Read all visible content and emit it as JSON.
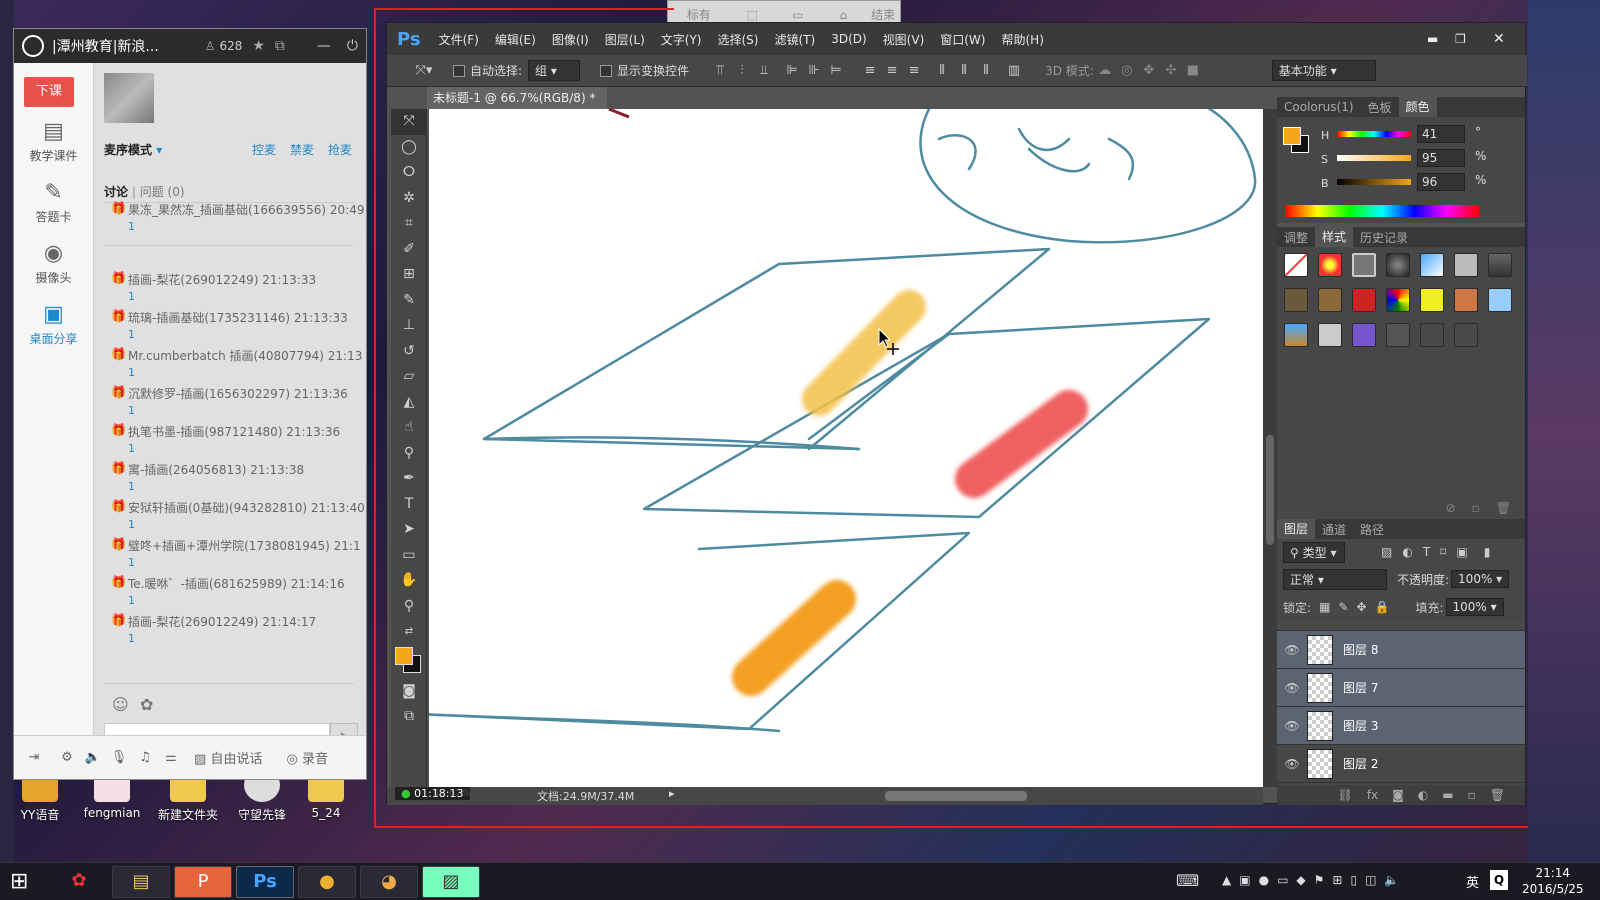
{
  "desktop": {
    "icons": [
      {
        "label": "YY语音"
      },
      {
        "label": "fengmian"
      },
      {
        "label": "新建文件夹"
      },
      {
        "label": "守望先锋"
      },
      {
        "label": "5_24"
      }
    ]
  },
  "top_toolbar": {
    "items": [
      "标有",
      "",
      "",
      "",
      "结束"
    ]
  },
  "yy": {
    "title": "|潭州教育|新浪...",
    "user_count": "628",
    "end_class": "下课",
    "sidebar": [
      "教学课件",
      "答题卡",
      "摄像头",
      "桌面分享"
    ],
    "mic_mode": "麦序模式",
    "actions": [
      "控麦",
      "禁麦",
      "抢麦"
    ],
    "tabs": {
      "discuss": "讨论",
      "questions": "问题 (0)"
    },
    "messages": [
      {
        "text": "果冻_果然冻_插画基础(166639556) 20:49",
        "num": "1"
      },
      {
        "text": "插画-梨花(269012249) 21:13:33",
        "num": "1"
      },
      {
        "text": "琉璃-插画基础(1735231146) 21:13:33",
        "num": "1"
      },
      {
        "text": "Mr.cumberbatch 插画(40807794) 21:13",
        "num": "1"
      },
      {
        "text": "沉默修罗-插画(1656302297) 21:13:36",
        "num": "1"
      },
      {
        "text": "执笔书墨-插画(987121480) 21:13:36",
        "num": "1"
      },
      {
        "text": "寓-插画(264056813) 21:13:38",
        "num": "1"
      },
      {
        "text": "安狱轩插画(0基础)(943282810) 21:13:40",
        "num": "1"
      },
      {
        "text": "璧咚+插画+潭州学院(1738081945) 21:1",
        "num": "1"
      },
      {
        "text": "Te.暖咻゛-插画(681625989) 21:14:16",
        "num": "1"
      },
      {
        "text": "插画-梨花(269012249) 21:14:17",
        "num": "1"
      }
    ],
    "bottom": {
      "free_talk": "自由说话",
      "record": "录音"
    }
  },
  "ps": {
    "logo": "Ps",
    "menu": [
      "文件(F)",
      "编辑(E)",
      "图像(I)",
      "图层(L)",
      "文字(Y)",
      "选择(S)",
      "滤镜(T)",
      "3D(D)",
      "视图(V)",
      "窗口(W)",
      "帮助(H)"
    ],
    "options": {
      "auto_select": "自动选择:",
      "group": "组",
      "show_transform": "显示变换控件",
      "mode_3d": "3D 模式:",
      "workspace": "基本功能"
    },
    "doc_tab": "未标题-1 @ 66.7%(RGB/8) *",
    "status": {
      "zoom": "66.67%",
      "doc": "文档:24.9M/37.4M",
      "timer": "01:18:13"
    },
    "color_tabs": [
      "Coolorus(1)",
      "色板",
      "颜色"
    ],
    "hsb": {
      "H": "41",
      "S": "95",
      "B": "96",
      "h_unit": "°",
      "s_unit": "%",
      "b_unit": "%"
    },
    "style_tabs": [
      "调整",
      "样式",
      "历史记录"
    ],
    "layers_tabs": [
      "图层",
      "通道",
      "路径"
    ],
    "layers_filter": "类型",
    "blend_mode": "正常",
    "opacity_label": "不透明度:",
    "opacity": "100%",
    "lock_label": "锁定:",
    "fill_label": "填充:",
    "fill": "100%",
    "layers": [
      {
        "name": "图层 8",
        "selected": true
      },
      {
        "name": "图层 7",
        "selected": true
      },
      {
        "name": "图层 3",
        "selected": true
      },
      {
        "name": "图层 2",
        "selected": false
      }
    ]
  },
  "taskbar": {
    "ime": "英",
    "time": "21:14",
    "date": "2016/5/25"
  },
  "colors": {
    "fg": "#f5a718",
    "bg": "#111111",
    "yy_red": "#e8504a",
    "accent_blue": "#1e88c8"
  }
}
